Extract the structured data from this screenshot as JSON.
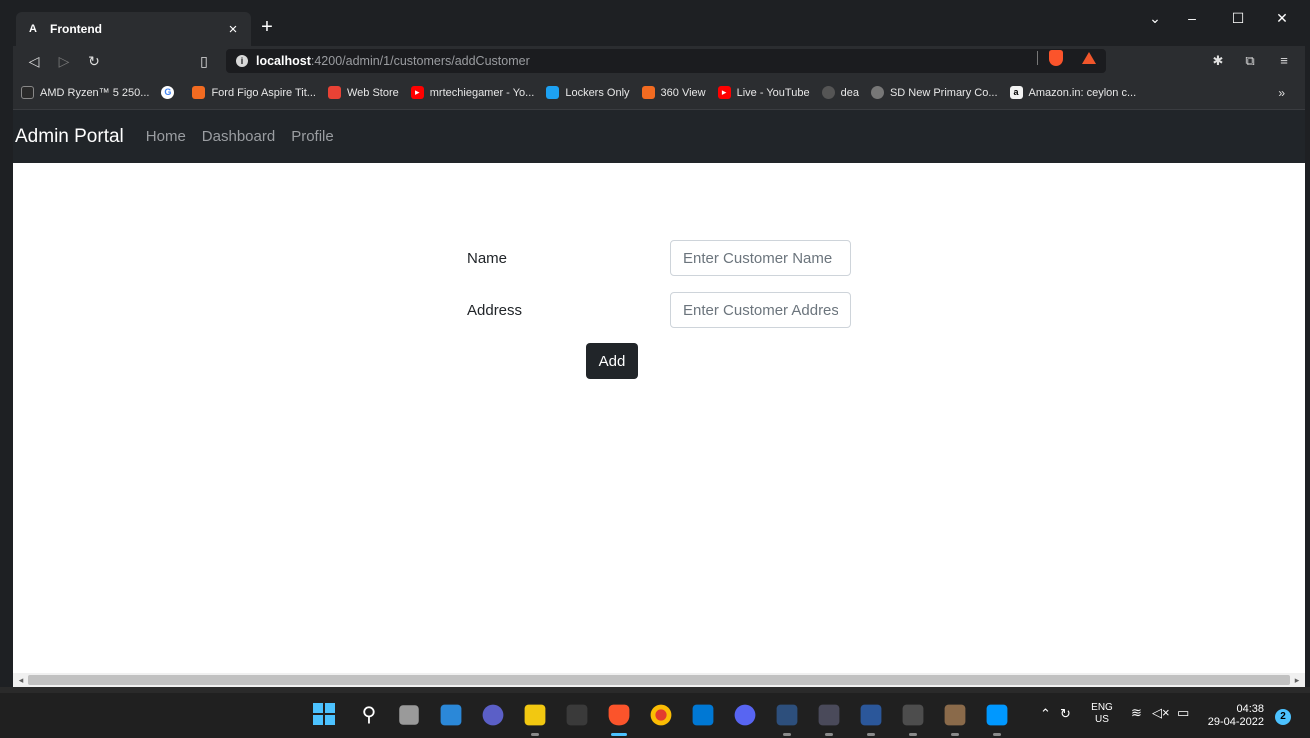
{
  "browser": {
    "tab_title": "Frontend",
    "tab_favicon": "A",
    "url_host": "localhost",
    "url_path": ":4200/admin/1/customers/addCustomer",
    "bookmarks": [
      {
        "label": "AMD Ryzen™ 5 250...",
        "icon": "amd-icon",
        "color": "#2a2a2a"
      },
      {
        "label": "",
        "icon": "google-icon",
        "color": "#4285f4"
      },
      {
        "label": "Ford Figo Aspire Tit...",
        "icon": "bookmark-site-icon",
        "color": "#f26b21"
      },
      {
        "label": "Web Store",
        "icon": "webstore-icon",
        "color": "#e94235"
      },
      {
        "label": "mrtechiegamer - Yo...",
        "icon": "youtube-icon",
        "color": "#ff0000"
      },
      {
        "label": "Lockers Only",
        "icon": "lockers-icon",
        "color": "#1da1f2"
      },
      {
        "label": "360 View",
        "icon": "bookmark-site-icon",
        "color": "#f26b21"
      },
      {
        "label": "Live - YouTube",
        "icon": "youtube-icon",
        "color": "#ff0000"
      },
      {
        "label": "dea",
        "icon": "dea-icon",
        "color": "#555555"
      },
      {
        "label": "SD New Primary Co...",
        "icon": "globe-icon",
        "color": "#777777"
      },
      {
        "label": "Amazon.in: ceylon c...",
        "icon": "amazon-icon",
        "color": "#f3f3f3"
      }
    ],
    "bookmarks_more": "»"
  },
  "navbar": {
    "brand": "Admin Portal",
    "links": [
      "Home",
      "Dashboard",
      "Profile"
    ]
  },
  "form": {
    "name_label": "Name",
    "name_placeholder": "Enter Customer Name",
    "address_label": "Address",
    "address_placeholder": "Enter Customer Address",
    "submit_label": "Add"
  },
  "taskbar": {
    "lang_line1": "ENG",
    "lang_line2": "US",
    "time": "04:38",
    "date": "29-04-2022",
    "notification_count": "2"
  },
  "colors": {
    "navbar_bg": "#212529",
    "button_bg": "#212529",
    "accent_blue": "#4cc2ff"
  }
}
